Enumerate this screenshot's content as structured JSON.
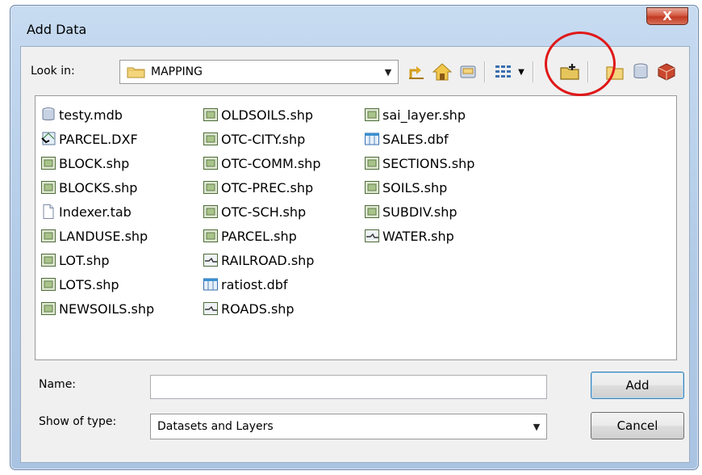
{
  "window": {
    "title": "Add Data",
    "close_glyph": "X"
  },
  "lookin": {
    "label": "Look in:",
    "value": "MAPPING"
  },
  "toolbar": {
    "icons": [
      "up-one-level-icon",
      "home-icon",
      "connect-to-folder-icon",
      "view-list-icon",
      "new-folder-icon",
      "new-folder-icon",
      "database-icon",
      "catalog-icon"
    ]
  },
  "files": [
    [
      {
        "name": "testy.mdb",
        "icon": "database-icon"
      },
      {
        "name": "PARCEL.DXF",
        "icon": "cad-icon"
      },
      {
        "name": "BLOCK.shp",
        "icon": "polygon-layer-icon"
      },
      {
        "name": "BLOCKS.shp",
        "icon": "polygon-layer-icon"
      },
      {
        "name": "Indexer.tab",
        "icon": "document-icon"
      },
      {
        "name": "LANDUSE.shp",
        "icon": "polygon-layer-icon"
      },
      {
        "name": "LOT.shp",
        "icon": "polygon-layer-icon"
      },
      {
        "name": "LOTS.shp",
        "icon": "polygon-layer-icon"
      },
      {
        "name": "NEWSOILS.shp",
        "icon": "polygon-layer-icon"
      }
    ],
    [
      {
        "name": "OLDSOILS.shp",
        "icon": "polygon-layer-icon"
      },
      {
        "name": "OTC-CITY.shp",
        "icon": "polygon-layer-icon"
      },
      {
        "name": "OTC-COMM.shp",
        "icon": "polygon-layer-icon"
      },
      {
        "name": "OTC-PREC.shp",
        "icon": "polygon-layer-icon"
      },
      {
        "name": "OTC-SCH.shp",
        "icon": "polygon-layer-icon"
      },
      {
        "name": "PARCEL.shp",
        "icon": "polygon-layer-icon"
      },
      {
        "name": "RAILROAD.shp",
        "icon": "line-layer-icon"
      },
      {
        "name": "ratiost.dbf",
        "icon": "table-icon"
      },
      {
        "name": "ROADS.shp",
        "icon": "line-layer-icon"
      }
    ],
    [
      {
        "name": "sai_layer.shp",
        "icon": "polygon-layer-icon"
      },
      {
        "name": "SALES.dbf",
        "icon": "table-icon"
      },
      {
        "name": "SECTIONS.shp",
        "icon": "polygon-layer-icon"
      },
      {
        "name": "SOILS.shp",
        "icon": "polygon-layer-icon"
      },
      {
        "name": "SUBDIV.shp",
        "icon": "polygon-layer-icon"
      },
      {
        "name": "WATER.shp",
        "icon": "line-layer-icon"
      }
    ]
  ],
  "name_field": {
    "label": "Name:",
    "value": ""
  },
  "type_field": {
    "label": "Show of type:",
    "value": "Datasets and Layers"
  },
  "buttons": {
    "add": "Add",
    "cancel": "Cancel"
  },
  "colors": {
    "highlight": "#e01818",
    "accent": "#3c7fb1",
    "close": "#c23a22"
  }
}
